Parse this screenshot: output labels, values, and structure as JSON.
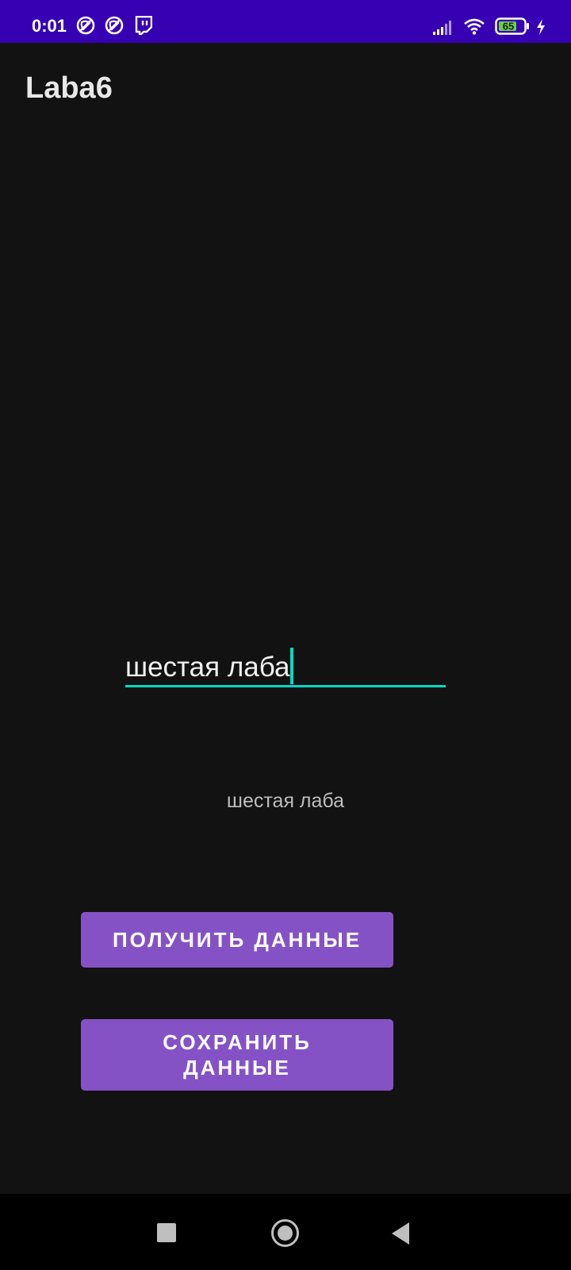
{
  "status_bar": {
    "time": "0:01",
    "battery_level": "65",
    "left_icons": [
      "notification-blocked-icon",
      "notification-blocked-icon",
      "twitch-icon"
    ],
    "right_icons": [
      "cell-signal-icon",
      "wifi-icon",
      "battery-icon",
      "charging-bolt-icon"
    ]
  },
  "app_bar": {
    "title": "Laba6"
  },
  "input": {
    "value": "шестая лаба",
    "accent": "#03dac5"
  },
  "output": {
    "text": "шестая лаба"
  },
  "buttons": {
    "get_label": "ПОЛУЧИТЬ ДАННЫЕ",
    "save_label": "СОХРАНИТЬ ДАННЫЕ",
    "color": "#8552c6"
  },
  "colors": {
    "status_bar": "#3700b3",
    "background": "#121212",
    "nav_bar": "#000000"
  },
  "nav_bar": {
    "icons": [
      "recents-icon",
      "home-icon",
      "back-icon"
    ]
  }
}
